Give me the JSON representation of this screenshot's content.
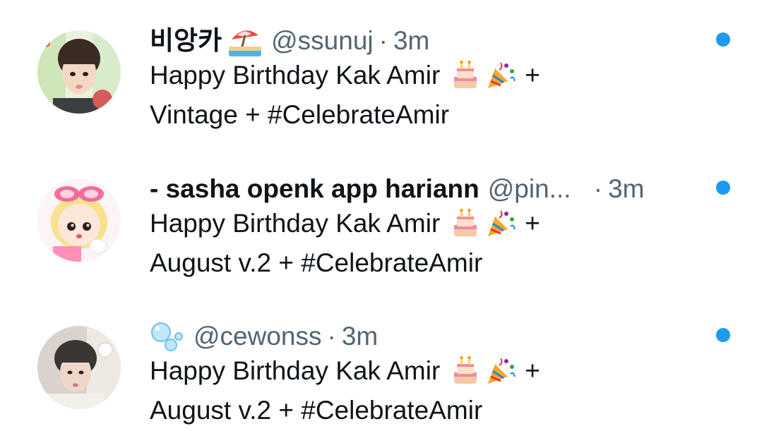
{
  "tweets": [
    {
      "name": "비앙카",
      "name_emoji": "beach-umbrella-icon",
      "handle": "@ssunuj",
      "separator": "·",
      "time": "3m",
      "text_line1": "Happy Birthday Kak Amir",
      "text_line1_end": "+",
      "text_line2": "Vintage + #CelebrateAmir",
      "emojis": [
        "birthday-cake-icon",
        "party-popper-icon"
      ],
      "unread": true
    },
    {
      "name": "- sasha openk app hariann",
      "handle": "@pin...",
      "separator": "·",
      "time": "3m",
      "text_line1": "Happy Birthday Kak Amir",
      "text_line1_end": "+",
      "text_line2": "August v.2 + #CelebrateAmir",
      "emojis": [
        "birthday-cake-icon",
        "party-popper-icon"
      ],
      "unread": true
    },
    {
      "name_emoji": "bubbles-icon",
      "handle": "@cewonss",
      "separator": "·",
      "time": "3m",
      "text_line1": "Happy Birthday Kak Amir",
      "text_line1_end": "+",
      "text_line2": "August v.2 + #CelebrateAmir",
      "emojis": [
        "birthday-cake-icon",
        "party-popper-icon"
      ],
      "unread": true
    }
  ],
  "colors": {
    "text": "#0f1419",
    "secondary": "#536471",
    "accent": "#1d9bf0"
  }
}
